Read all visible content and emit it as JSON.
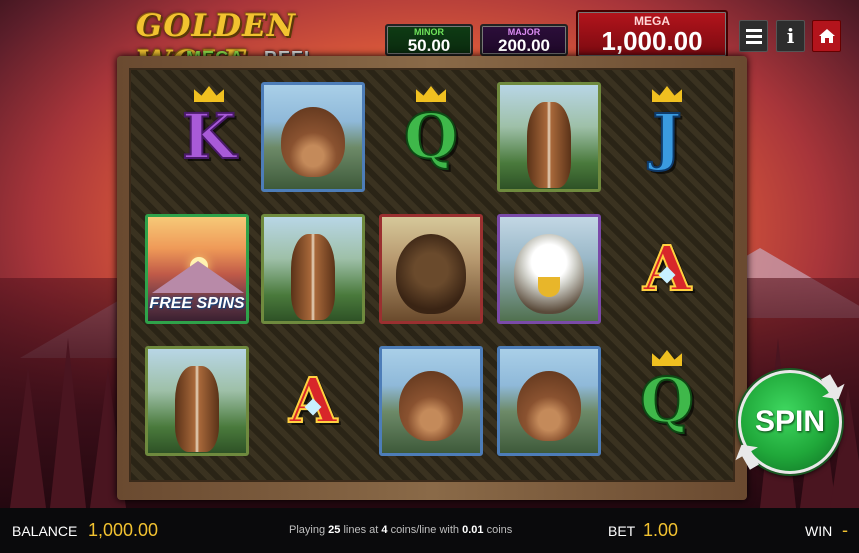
{
  "logo": {
    "title": "GOLDEN WOLF",
    "sub1": "MEGA",
    "sub2": "REEL"
  },
  "jackpots": {
    "minor": {
      "label": "MINOR",
      "value": "50.00"
    },
    "major": {
      "label": "MAJOR",
      "value": "200.00"
    },
    "mega": {
      "label": "MEGA",
      "value": "1,000.00"
    }
  },
  "buttons": {
    "info": "i"
  },
  "reels": [
    [
      "K",
      "bear",
      "Q",
      "horse",
      "J"
    ],
    [
      "free-spins",
      "horse",
      "bison",
      "eagle",
      "A"
    ],
    [
      "horse",
      "A",
      "bear",
      "bear",
      "Q"
    ]
  ],
  "symbols": {
    "K": "K",
    "Q": "Q",
    "J": "J",
    "A": "A",
    "free_spins": "FREE SPINS"
  },
  "spin": {
    "label": "SPIN"
  },
  "footer": {
    "balance_label": "BALANCE",
    "balance_value": "1,000.00",
    "info_prefix": "Playing",
    "lines": "25",
    "info_mid1": "lines at",
    "coins": "4",
    "info_mid2": "coins/line with",
    "coin_value": "0.01",
    "info_suffix": "coins",
    "bet_label": "BET",
    "bet_value": "1.00",
    "win_label": "WIN",
    "win_value": "-"
  },
  "colors": {
    "gold": "#f2c230",
    "mega_red": "#b3141c",
    "spin_green": "#20a83a"
  }
}
